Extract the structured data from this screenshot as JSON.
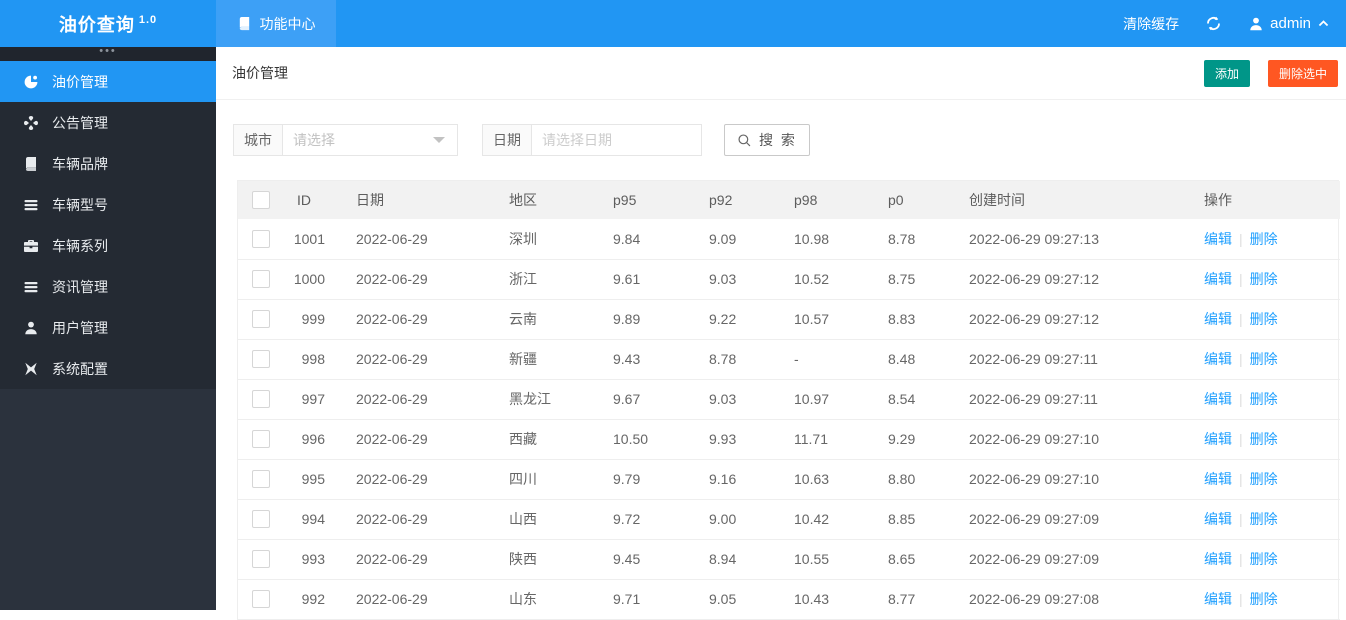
{
  "app": {
    "title": "油价查询",
    "version": "1.0"
  },
  "colors": {
    "header_blue": "#2196f3",
    "active_tab_blue": "#3da0f6",
    "sidebar_dark": "#2b323d",
    "add_button_teal": "#009688",
    "delete_button_orange": "#ff5722",
    "link_blue": "#1e9fff"
  },
  "header": {
    "tab": {
      "label": "功能中心",
      "icon": "book-icon"
    },
    "clear_cache": "清除缓存",
    "refresh_icon": "refresh-icon",
    "user": {
      "name": "admin",
      "icon": "user-icon",
      "caret": "chevron-up-icon"
    }
  },
  "sidebar": {
    "collapse_dots": "•••",
    "items": [
      {
        "label": "油价管理",
        "icon": "oil-price",
        "active": true
      },
      {
        "label": "公告管理",
        "icon": "notice",
        "active": false
      },
      {
        "label": "车辆品牌",
        "icon": "book",
        "active": false
      },
      {
        "label": "车辆型号",
        "icon": "list",
        "active": false
      },
      {
        "label": "车辆系列",
        "icon": "briefcase",
        "active": false
      },
      {
        "label": "资讯管理",
        "icon": "list",
        "active": false
      },
      {
        "label": "用户管理",
        "icon": "user",
        "active": false
      },
      {
        "label": "系统配置",
        "icon": "pinwheel",
        "active": false
      }
    ]
  },
  "main": {
    "page_title": "油价管理",
    "buttons": {
      "add": "添加",
      "delete_selected": "删除选中"
    },
    "filters": {
      "city": {
        "label": "城市",
        "placeholder": "请选择"
      },
      "date": {
        "label": "日期",
        "placeholder": "请选择日期"
      },
      "search_label": "搜 索"
    },
    "table": {
      "columns": [
        "ID",
        "日期",
        "地区",
        "p95",
        "p92",
        "p98",
        "p0",
        "创建时间",
        "操作"
      ],
      "actions": {
        "edit": "编辑",
        "delete": "删除"
      },
      "rows": [
        {
          "id": "1001",
          "date": "2022-06-29",
          "region": "深圳",
          "p95": "9.84",
          "p92": "9.09",
          "p98": "10.98",
          "p0": "8.78",
          "created": "2022-06-29 09:27:13"
        },
        {
          "id": "1000",
          "date": "2022-06-29",
          "region": "浙江",
          "p95": "9.61",
          "p92": "9.03",
          "p98": "10.52",
          "p0": "8.75",
          "created": "2022-06-29 09:27:12"
        },
        {
          "id": "999",
          "date": "2022-06-29",
          "region": "云南",
          "p95": "9.89",
          "p92": "9.22",
          "p98": "10.57",
          "p0": "8.83",
          "created": "2022-06-29 09:27:12"
        },
        {
          "id": "998",
          "date": "2022-06-29",
          "region": "新疆",
          "p95": "9.43",
          "p92": "8.78",
          "p98": "-",
          "p0": "8.48",
          "created": "2022-06-29 09:27:11"
        },
        {
          "id": "997",
          "date": "2022-06-29",
          "region": "黑龙江",
          "p95": "9.67",
          "p92": "9.03",
          "p98": "10.97",
          "p0": "8.54",
          "created": "2022-06-29 09:27:11"
        },
        {
          "id": "996",
          "date": "2022-06-29",
          "region": "西藏",
          "p95": "10.50",
          "p92": "9.93",
          "p98": "11.71",
          "p0": "9.29",
          "created": "2022-06-29 09:27:10"
        },
        {
          "id": "995",
          "date": "2022-06-29",
          "region": "四川",
          "p95": "9.79",
          "p92": "9.16",
          "p98": "10.63",
          "p0": "8.80",
          "created": "2022-06-29 09:27:10"
        },
        {
          "id": "994",
          "date": "2022-06-29",
          "region": "山西",
          "p95": "9.72",
          "p92": "9.00",
          "p98": "10.42",
          "p0": "8.85",
          "created": "2022-06-29 09:27:09"
        },
        {
          "id": "993",
          "date": "2022-06-29",
          "region": "陕西",
          "p95": "9.45",
          "p92": "8.94",
          "p98": "10.55",
          "p0": "8.65",
          "created": "2022-06-29 09:27:09"
        },
        {
          "id": "992",
          "date": "2022-06-29",
          "region": "山东",
          "p95": "9.71",
          "p92": "9.05",
          "p98": "10.43",
          "p0": "8.77",
          "created": "2022-06-29 09:27:08"
        }
      ]
    }
  }
}
